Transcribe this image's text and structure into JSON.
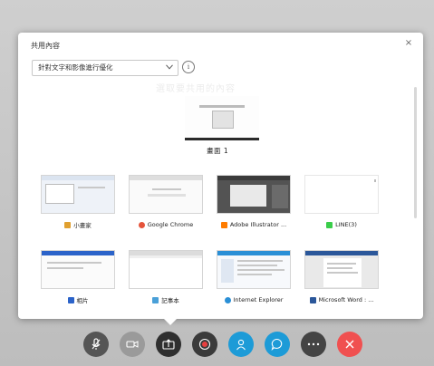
{
  "dialog": {
    "title": "共用內容",
    "close_symbol": "×",
    "dropdown_value": "針對文字和影像進行優化",
    "info_symbol": "i",
    "ghost_text": "選取要共用的內容"
  },
  "screens": [
    {
      "label": "畫面 1"
    }
  ],
  "apps": [
    {
      "label": "小畫家",
      "icon": "paint-icon",
      "icon_color": "#e0a030"
    },
    {
      "label": "Google Chrome",
      "icon": "chrome-icon",
      "icon_color": "#e5543b"
    },
    {
      "label": "Adobe Illustrator ...",
      "icon": "illustrator-icon",
      "icon_color": "#ff7c00"
    },
    {
      "label": "LINE(3)",
      "icon": "line-icon",
      "icon_color": "#3acd4a"
    },
    {
      "label": "相片",
      "icon": "photos-icon",
      "icon_color": "#2b63c9"
    },
    {
      "label": "記事本",
      "icon": "notepad-icon",
      "icon_color": "#4aa0d8"
    },
    {
      "label": "Internet Explorer",
      "icon": "ie-icon",
      "icon_color": "#2a8fd6"
    },
    {
      "label": "Microsoft Word : ...",
      "icon": "word-icon",
      "icon_color": "#2b579a"
    }
  ],
  "toolbar": {
    "buttons": [
      {
        "name": "mute-button",
        "icon": "microphone-icon",
        "color": "#555555"
      },
      {
        "name": "video-button",
        "icon": "camera-icon",
        "color": "#9a9a9a"
      },
      {
        "name": "share-button",
        "icon": "share-icon",
        "color": "#2f2f2f"
      },
      {
        "name": "record-button",
        "icon": "record-icon",
        "color": "#3a3a3a"
      },
      {
        "name": "participants-button",
        "icon": "person-icon",
        "color": "#1d9bd7"
      },
      {
        "name": "chat-button",
        "icon": "chat-icon",
        "color": "#1d9bd7"
      },
      {
        "name": "more-button",
        "icon": "more-icon",
        "color": "#444444"
      },
      {
        "name": "leave-button",
        "icon": "close-icon",
        "color": "#f05050"
      }
    ]
  }
}
